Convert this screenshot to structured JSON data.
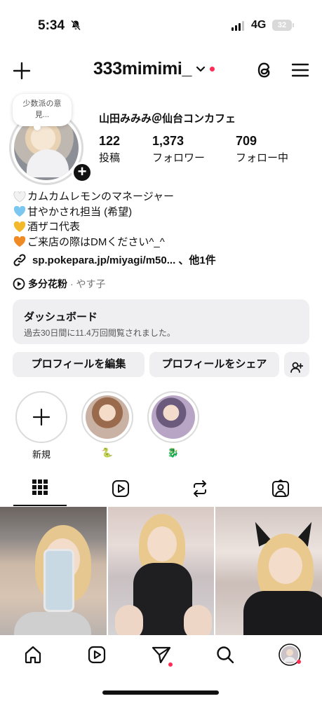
{
  "status_bar": {
    "time": "5:34",
    "network": "4G",
    "battery": "32"
  },
  "header": {
    "username": "333mimimi_"
  },
  "profile": {
    "note": "少数派の意見...",
    "display_name": "山田みみみ＠仙台コンカフェ",
    "stats": [
      {
        "num": "122",
        "label": "投稿"
      },
      {
        "num": "1,373",
        "label": "フォロワー"
      },
      {
        "num": "709",
        "label": "フォロー中"
      }
    ],
    "bio": [
      {
        "heart_color": "#f2f2f2",
        "text": "カムカムレモンのマネージャー"
      },
      {
        "heart_color": "#7cc7ef",
        "text": "甘やかされ担当 (希望)"
      },
      {
        "heart_color": "#f4b92a",
        "text": "酒ザコ代表"
      },
      {
        "heart_color": "#f08a24",
        "text": "ご来店の際はDMください^_^"
      }
    ],
    "link": "sp.pokepara.jp/miyagi/m50... 、他1件",
    "music": {
      "song": "多分花粉",
      "artist": "· やす子"
    }
  },
  "dashboard": {
    "title": "ダッシュボード",
    "subtitle": "過去30日間に11.4万回閲覧されました。"
  },
  "buttons": {
    "edit": "プロフィールを編集",
    "share": "プロフィールをシェア"
  },
  "highlights": [
    {
      "caption": "新規"
    },
    {
      "caption": "🐍"
    },
    {
      "caption": "🐉"
    }
  ],
  "colors": {
    "accent_dot": "#ff2d55",
    "button_bg": "#efeff1"
  },
  "icons": [
    "plus-icon",
    "chevron-down-icon",
    "threads-icon",
    "menu-icon",
    "grid-icon",
    "reels-icon",
    "repost-icon",
    "tagged-icon",
    "home-icon",
    "reels-nav-icon",
    "direct-icon",
    "search-icon",
    "profile-avatar-icon",
    "add-person-icon",
    "link-icon",
    "music-play-icon"
  ]
}
